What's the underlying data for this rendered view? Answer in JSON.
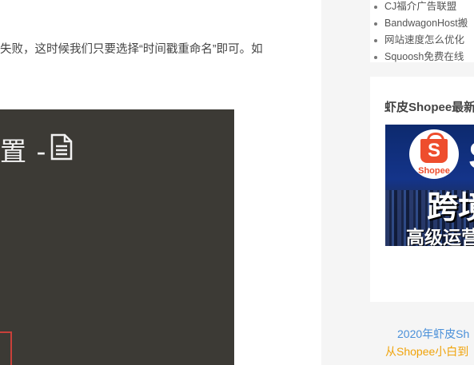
{
  "article": {
    "paragraph": "失败，这时候我们只要选择“时间戳重命名”即可。如"
  },
  "screenshot": {
    "title_text": "置 -"
  },
  "sidebar": {
    "recent_posts": [
      "CJ福介广告联盟",
      "BandwagonHost搬",
      "网站速度怎么优化",
      "Squoosh免费在线"
    ],
    "ad_widget": {
      "title": "虾皮Shopee最新",
      "logo_word": "Shopee",
      "banner_headline": "跨境",
      "banner_subline": "高级运营",
      "caption": "2020年虾皮Sh",
      "promo": "从Shopee小白到"
    }
  },
  "colors": {
    "screenshot_bg": "#3c3a35",
    "highlight_red": "#c9403a",
    "link_blue": "#4a90d9",
    "promo_orange": "#f0a30a",
    "shopee_orange": "#ee4d2d"
  }
}
